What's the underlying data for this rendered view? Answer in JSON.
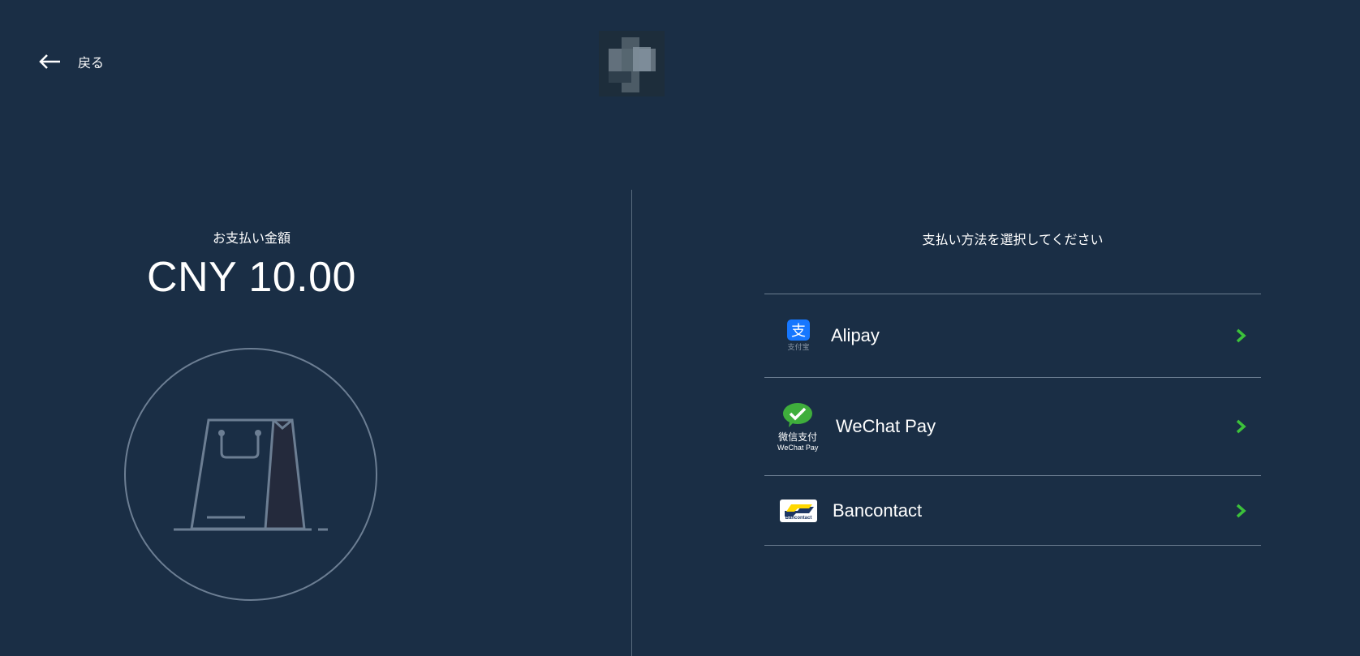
{
  "header": {
    "back_label": "戻る",
    "back_icon": "arrow-left-icon",
    "logo_icon": "merchant-logo"
  },
  "summary": {
    "amount_label": "お支払い金額",
    "amount_value": "CNY 10.00",
    "illustration_icon": "shopping-bag-icon"
  },
  "payment": {
    "title": "支払い方法を選択してください",
    "methods": [
      {
        "name": "Alipay",
        "icon": "alipay-icon",
        "icon_caption": "支付宝",
        "icon_color": "#1677ff"
      },
      {
        "name": "WeChat Pay",
        "icon": "wechat-pay-icon",
        "icon_caption_cn": "微信支付",
        "icon_caption_en": "WeChat Pay",
        "icon_color": "#3fae3c"
      },
      {
        "name": "Bancontact",
        "icon": "bancontact-icon",
        "icon_caption": "Bancontact",
        "icon_color": "#ffd800"
      }
    ],
    "chevron_color": "#3cc13b"
  },
  "colors": {
    "background": "#1a2e45",
    "divider": "#596b7f",
    "illustration_stroke": "#6c7e93"
  }
}
